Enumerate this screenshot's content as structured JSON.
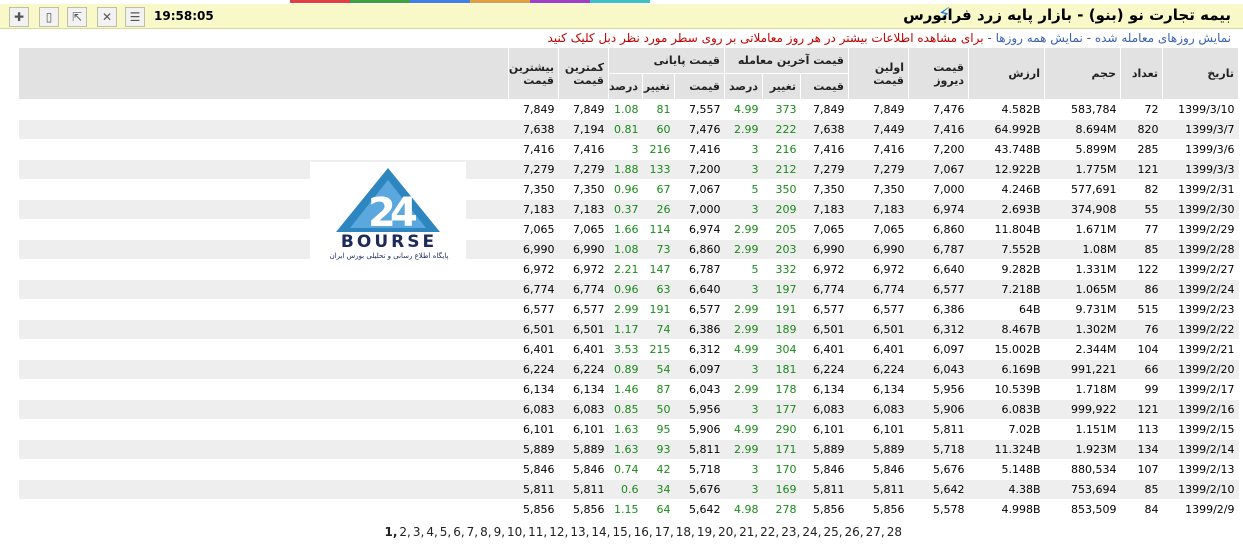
{
  "header": {
    "title": "بیمه تجارت نو (بنو) - بازار پایه زرد فرابورس",
    "clock": "19:58:05"
  },
  "links": {
    "traded_days": "نمایش روزهای معامله شده",
    "separator": "-",
    "all_days": "نمایش همه روزها",
    "separator2": "-",
    "hint": "برای مشاهده اطلاعات بیشتر در هر روز معاملاتی بر روی سطر مورد نظر دبل کلیک کنید"
  },
  "columns": {
    "date": "تاریخ",
    "count": "تعداد",
    "volume": "حجم",
    "value": "ارزش",
    "prev_price": "قیمت دیروز",
    "first_price": "اولین قیمت",
    "last_trade_group": "قیمت آخرین معامله",
    "final_price_group": "قیمت پایانی",
    "price": "قیمت",
    "change": "تغییر",
    "percent": "درصد",
    "min_price": "کمترین قیمت",
    "max_price": "بیشترین قیمت"
  },
  "rows": [
    {
      "date": "1399/3/10",
      "count": "72",
      "volume": "583,784",
      "value": "4.582B",
      "prev": "7,476",
      "first": "7,849",
      "last_price": "7,849",
      "last_change": "373",
      "last_pct": "4.99",
      "final_price": "7,557",
      "final_change": "81",
      "final_pct": "1.08",
      "min": "7,849",
      "max": "7,849"
    },
    {
      "date": "1399/3/7",
      "count": "820",
      "volume": "8.694M",
      "value": "64.992B",
      "prev": "7,416",
      "first": "7,449",
      "last_price": "7,638",
      "last_change": "222",
      "last_pct": "2.99",
      "final_price": "7,476",
      "final_change": "60",
      "final_pct": "0.81",
      "min": "7,194",
      "max": "7,638"
    },
    {
      "date": "1399/3/6",
      "count": "285",
      "volume": "5.899M",
      "value": "43.748B",
      "prev": "7,200",
      "first": "7,416",
      "last_price": "7,416",
      "last_change": "216",
      "last_pct": "3",
      "final_price": "7,416",
      "final_change": "216",
      "final_pct": "3",
      "min": "7,416",
      "max": "7,416"
    },
    {
      "date": "1399/3/3",
      "count": "121",
      "volume": "1.775M",
      "value": "12.922B",
      "prev": "7,067",
      "first": "7,279",
      "last_price": "7,279",
      "last_change": "212",
      "last_pct": "3",
      "final_price": "7,200",
      "final_change": "133",
      "final_pct": "1.88",
      "min": "7,279",
      "max": "7,279"
    },
    {
      "date": "1399/2/31",
      "count": "82",
      "volume": "577,691",
      "value": "4.246B",
      "prev": "7,000",
      "first": "7,350",
      "last_price": "7,350",
      "last_change": "350",
      "last_pct": "5",
      "final_price": "7,067",
      "final_change": "67",
      "final_pct": "0.96",
      "min": "7,350",
      "max": "7,350"
    },
    {
      "date": "1399/2/30",
      "count": "55",
      "volume": "374,908",
      "value": "2.693B",
      "prev": "6,974",
      "first": "7,183",
      "last_price": "7,183",
      "last_change": "209",
      "last_pct": "3",
      "final_price": "7,000",
      "final_change": "26",
      "final_pct": "0.37",
      "min": "7,183",
      "max": "7,183"
    },
    {
      "date": "1399/2/29",
      "count": "77",
      "volume": "1.671M",
      "value": "11.804B",
      "prev": "6,860",
      "first": "7,065",
      "last_price": "7,065",
      "last_change": "205",
      "last_pct": "2.99",
      "final_price": "6,974",
      "final_change": "114",
      "final_pct": "1.66",
      "min": "7,065",
      "max": "7,065"
    },
    {
      "date": "1399/2/28",
      "count": "85",
      "volume": "1.08M",
      "value": "7.552B",
      "prev": "6,787",
      "first": "6,990",
      "last_price": "6,990",
      "last_change": "203",
      "last_pct": "2.99",
      "final_price": "6,860",
      "final_change": "73",
      "final_pct": "1.08",
      "min": "6,990",
      "max": "6,990"
    },
    {
      "date": "1399/2/27",
      "count": "122",
      "volume": "1.331M",
      "value": "9.282B",
      "prev": "6,640",
      "first": "6,972",
      "last_price": "6,972",
      "last_change": "332",
      "last_pct": "5",
      "final_price": "6,787",
      "final_change": "147",
      "final_pct": "2.21",
      "min": "6,972",
      "max": "6,972"
    },
    {
      "date": "1399/2/24",
      "count": "86",
      "volume": "1.065M",
      "value": "7.218B",
      "prev": "6,577",
      "first": "6,774",
      "last_price": "6,774",
      "last_change": "197",
      "last_pct": "3",
      "final_price": "6,640",
      "final_change": "63",
      "final_pct": "0.96",
      "min": "6,774",
      "max": "6,774"
    },
    {
      "date": "1399/2/23",
      "count": "515",
      "volume": "9.731M",
      "value": "64B",
      "prev": "6,386",
      "first": "6,577",
      "last_price": "6,577",
      "last_change": "191",
      "last_pct": "2.99",
      "final_price": "6,577",
      "final_change": "191",
      "final_pct": "2.99",
      "min": "6,577",
      "max": "6,577"
    },
    {
      "date": "1399/2/22",
      "count": "76",
      "volume": "1.302M",
      "value": "8.467B",
      "prev": "6,312",
      "first": "6,501",
      "last_price": "6,501",
      "last_change": "189",
      "last_pct": "2.99",
      "final_price": "6,386",
      "final_change": "74",
      "final_pct": "1.17",
      "min": "6,501",
      "max": "6,501"
    },
    {
      "date": "1399/2/21",
      "count": "104",
      "volume": "2.344M",
      "value": "15.002B",
      "prev": "6,097",
      "first": "6,401",
      "last_price": "6,401",
      "last_change": "304",
      "last_pct": "4.99",
      "final_price": "6,312",
      "final_change": "215",
      "final_pct": "3.53",
      "min": "6,401",
      "max": "6,401"
    },
    {
      "date": "1399/2/20",
      "count": "66",
      "volume": "991,221",
      "value": "6.169B",
      "prev": "6,043",
      "first": "6,224",
      "last_price": "6,224",
      "last_change": "181",
      "last_pct": "3",
      "final_price": "6,097",
      "final_change": "54",
      "final_pct": "0.89",
      "min": "6,224",
      "max": "6,224"
    },
    {
      "date": "1399/2/17",
      "count": "99",
      "volume": "1.718M",
      "value": "10.539B",
      "prev": "5,956",
      "first": "6,134",
      "last_price": "6,134",
      "last_change": "178",
      "last_pct": "2.99",
      "final_price": "6,043",
      "final_change": "87",
      "final_pct": "1.46",
      "min": "6,134",
      "max": "6,134"
    },
    {
      "date": "1399/2/16",
      "count": "121",
      "volume": "999,922",
      "value": "6.083B",
      "prev": "5,906",
      "first": "6,083",
      "last_price": "6,083",
      "last_change": "177",
      "last_pct": "3",
      "final_price": "5,956",
      "final_change": "50",
      "final_pct": "0.85",
      "min": "6,083",
      "max": "6,083"
    },
    {
      "date": "1399/2/15",
      "count": "113",
      "volume": "1.151M",
      "value": "7.02B",
      "prev": "5,811",
      "first": "6,101",
      "last_price": "6,101",
      "last_change": "290",
      "last_pct": "4.99",
      "final_price": "5,906",
      "final_change": "95",
      "final_pct": "1.63",
      "min": "6,101",
      "max": "6,101"
    },
    {
      "date": "1399/2/14",
      "count": "134",
      "volume": "1.923M",
      "value": "11.324B",
      "prev": "5,718",
      "first": "5,889",
      "last_price": "5,889",
      "last_change": "171",
      "last_pct": "2.99",
      "final_price": "5,811",
      "final_change": "93",
      "final_pct": "1.63",
      "min": "5,889",
      "max": "5,889"
    },
    {
      "date": "1399/2/13",
      "count": "107",
      "volume": "880,534",
      "value": "5.148B",
      "prev": "5,676",
      "first": "5,846",
      "last_price": "5,846",
      "last_change": "170",
      "last_pct": "3",
      "final_price": "5,718",
      "final_change": "42",
      "final_pct": "0.74",
      "min": "5,846",
      "max": "5,846"
    },
    {
      "date": "1399/2/10",
      "count": "85",
      "volume": "753,694",
      "value": "4.38B",
      "prev": "5,642",
      "first": "5,811",
      "last_price": "5,811",
      "last_change": "169",
      "last_pct": "3",
      "final_price": "5,676",
      "final_change": "34",
      "final_pct": "0.6",
      "min": "5,811",
      "max": "5,811"
    },
    {
      "date": "1399/2/9",
      "count": "84",
      "volume": "853,509",
      "value": "4.998B",
      "prev": "5,578",
      "first": "5,856",
      "last_price": "5,856",
      "last_change": "278",
      "last_pct": "4.98",
      "final_price": "5,642",
      "final_change": "64",
      "final_pct": "1.15",
      "min": "5,856",
      "max": "5,856"
    }
  ],
  "logo": {
    "wordmark": "BOURSE",
    "tagline": "پایگاه اطلاع رسانی و تحلیلی بورس ایران",
    "accent": "#2e86c1"
  },
  "pager": {
    "current": "1,",
    "pages": [
      "2,",
      "3,",
      "4,",
      "5,",
      "6,",
      "7,",
      "8,",
      "9,",
      "10,",
      "11,",
      "12,",
      "13,",
      "14,",
      "15,",
      "16,",
      "17,",
      "18,",
      "19,",
      "20,",
      "21,",
      "22,",
      "23,",
      "24,",
      "25,",
      "26,",
      "27,",
      "28"
    ]
  },
  "toolbar": {
    "icons": [
      "add-icon",
      "document-icon",
      "export-icon",
      "chart-icon",
      "table-icon"
    ]
  },
  "colors": {
    "header_bg": "#f8f8c8",
    "link": "#3a62b0",
    "hint": "#c00000",
    "positive": "#1a8a1a",
    "bolt": "#1f7de0"
  }
}
